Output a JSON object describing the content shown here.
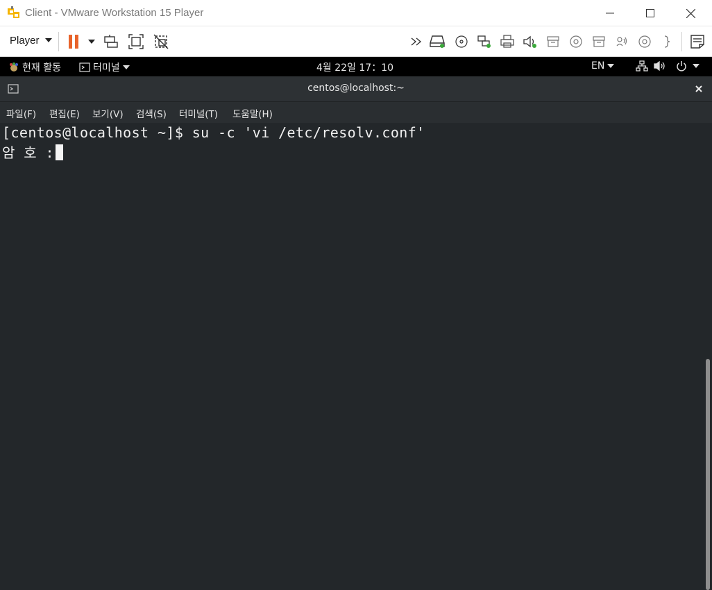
{
  "window": {
    "title": "Client - VMware Workstation 15 Player"
  },
  "toolbar": {
    "player_label": "Player"
  },
  "gnome": {
    "activities": "현재 활동",
    "app_menu": "터미널",
    "clock": "4월 22일  17：10",
    "lang": "EN"
  },
  "terminal_window": {
    "title": "centos@localhost:~"
  },
  "menu": {
    "file": "파일(F)",
    "edit": "편집(E)",
    "view": "보기(V)",
    "search": "검색(S)",
    "terminal": "터미널(T)",
    "help": "도움말(H)"
  },
  "terminal": {
    "line1": "[centos@localhost ~]$ su -c 'vi /etc/resolv.conf'",
    "line2": "암 호 :"
  },
  "colors": {
    "accent_pause": "#e8632b",
    "terminal_bg": "#23272a",
    "gnome_bar": "#000000"
  }
}
